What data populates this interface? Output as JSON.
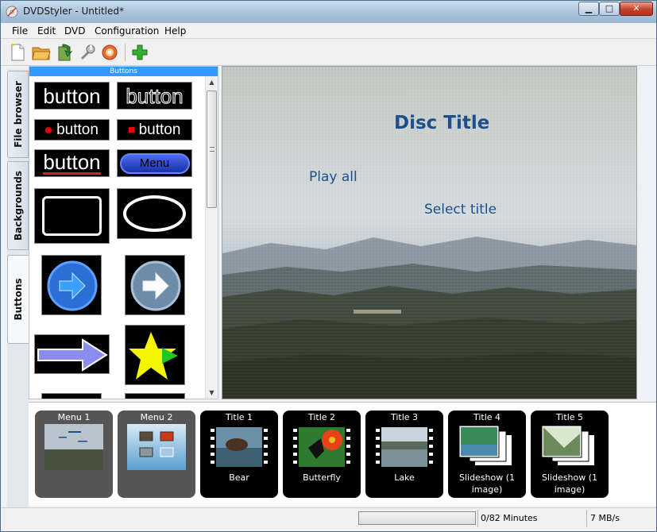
{
  "window": {
    "title": "DVDStyler - Untitled*",
    "min_glyph": "▁",
    "max_glyph": "□",
    "close_glyph": "✕"
  },
  "menubar": {
    "items": [
      "File",
      "Edit",
      "DVD",
      "Configuration",
      "Help"
    ]
  },
  "toolbar": {
    "buttons": [
      "new-icon",
      "open-icon",
      "save-icon",
      "settings-icon",
      "burn-icon",
      "add-icon"
    ]
  },
  "sidetabs": {
    "tabs": [
      "File browser",
      "Backgrounds",
      "Buttons"
    ],
    "active": "Buttons"
  },
  "panel": {
    "header": "Buttons",
    "items": [
      {
        "kind": "text",
        "label": "button"
      },
      {
        "kind": "text-outline",
        "label": "button"
      },
      {
        "kind": "dot-text",
        "label": "button"
      },
      {
        "kind": "square-text",
        "label": "button"
      },
      {
        "kind": "underline-text",
        "label": "button"
      },
      {
        "kind": "pill",
        "label": "Menu"
      }
    ]
  },
  "preview": {
    "disc_title": "Disc Title",
    "buttons": [
      "Play all",
      "Select title"
    ]
  },
  "titles": [
    {
      "label": "Menu 1",
      "kind": "menu",
      "caption": ""
    },
    {
      "label": "Menu 2",
      "kind": "menu",
      "caption": ""
    },
    {
      "label": "Title 1",
      "kind": "film",
      "caption": "Bear"
    },
    {
      "label": "Title 2",
      "kind": "film",
      "caption": "Butterfly"
    },
    {
      "label": "Title 3",
      "kind": "film",
      "caption": "Lake"
    },
    {
      "label": "Title 4",
      "kind": "slideshow",
      "caption": "Slideshow (1 image)"
    },
    {
      "label": "Title 5",
      "kind": "slideshow",
      "caption": "Slideshow (1 image)"
    }
  ],
  "status": {
    "minutes": "0/82 Minutes",
    "rate": "7 MB/s",
    "progress": 0
  }
}
